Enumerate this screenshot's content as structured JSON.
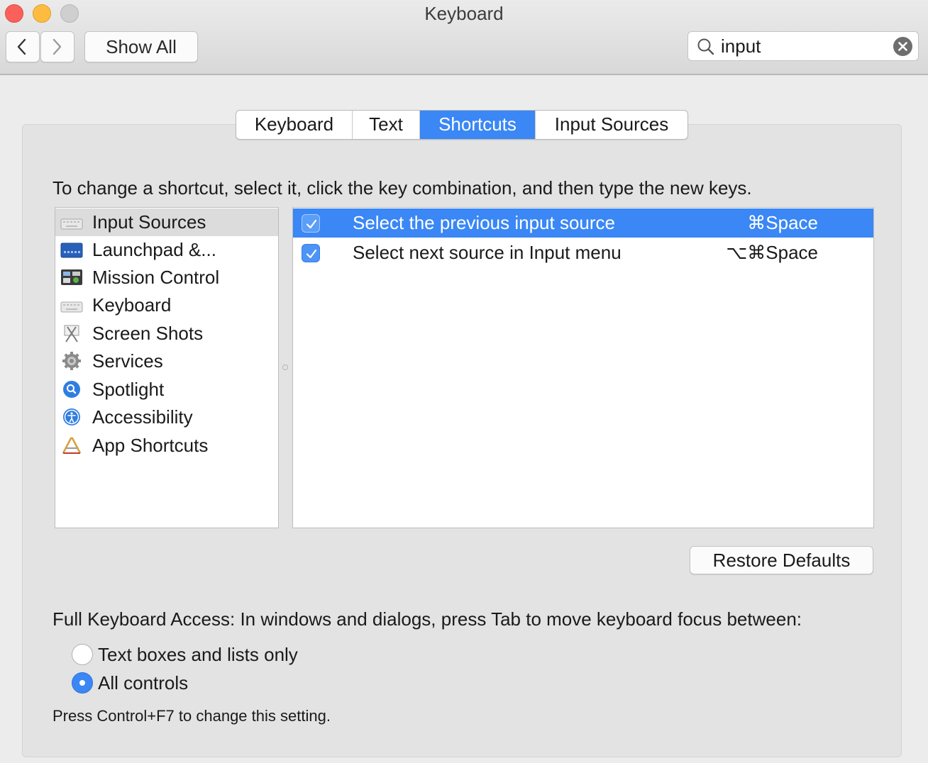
{
  "window": {
    "title": "Keyboard",
    "show_all_label": "Show All",
    "search_value": "input"
  },
  "tabs": [
    {
      "label": "Keyboard",
      "active": false
    },
    {
      "label": "Text",
      "active": false
    },
    {
      "label": "Shortcuts",
      "active": true
    },
    {
      "label": "Input Sources",
      "active": false
    }
  ],
  "instruction": "To change a shortcut, select it, click the key combination, and then type the new keys.",
  "categories": [
    {
      "label": "Input Sources",
      "icon": "keyboard-icon",
      "selected": true
    },
    {
      "label": "Launchpad &...",
      "icon": "launchpad-icon",
      "selected": false
    },
    {
      "label": "Mission Control",
      "icon": "mission-control-icon",
      "selected": false
    },
    {
      "label": "Keyboard",
      "icon": "keyboard-icon",
      "selected": false
    },
    {
      "label": "Screen Shots",
      "icon": "screenshot-icon",
      "selected": false
    },
    {
      "label": "Services",
      "icon": "gear-icon",
      "selected": false
    },
    {
      "label": "Spotlight",
      "icon": "spotlight-icon",
      "selected": false
    },
    {
      "label": "Accessibility",
      "icon": "accessibility-icon",
      "selected": false
    },
    {
      "label": "App Shortcuts",
      "icon": "app-shortcuts-icon",
      "selected": false
    }
  ],
  "shortcuts": [
    {
      "enabled": true,
      "description": "Select the previous input source",
      "keys": "⌘Space",
      "selected": true
    },
    {
      "enabled": true,
      "description": "Select next source in Input menu",
      "keys": "⌥⌘Space",
      "selected": false
    }
  ],
  "restore_defaults_label": "Restore Defaults",
  "full_keyboard_access": {
    "heading": "Full Keyboard Access: In windows and dialogs, press Tab to move keyboard focus between:",
    "options": [
      {
        "label": "Text boxes and lists only",
        "selected": false
      },
      {
        "label": "All controls",
        "selected": true
      }
    ],
    "note": "Press Control+F7 to change this setting."
  },
  "colors": {
    "accent": "#3a87f5",
    "close": "#fc605b",
    "minimize": "#fdbc40",
    "zoom_disabled": "#cfcfcf"
  }
}
